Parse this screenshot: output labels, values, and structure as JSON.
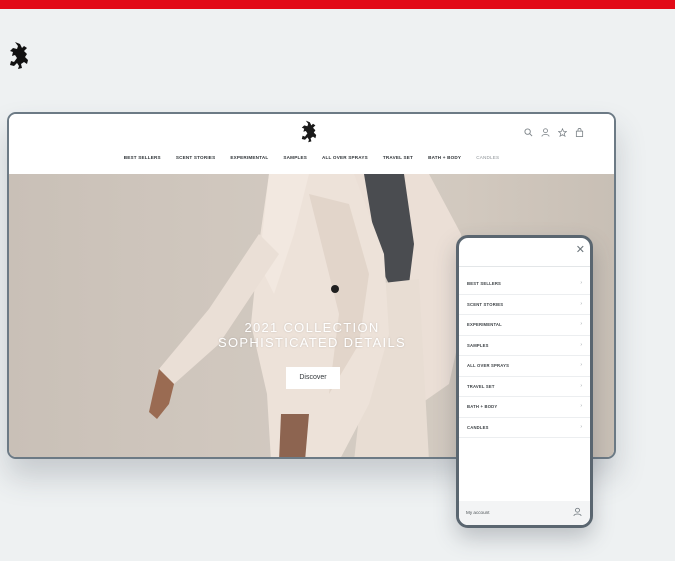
{
  "brand": {
    "accent_color": "#e20a17",
    "logo_icon": "heraldic-lion-icon"
  },
  "desktop": {
    "header_icons": [
      "search-icon",
      "account-icon",
      "wishlist-icon",
      "bag-icon"
    ],
    "nav": {
      "items": [
        "BEST SELLERS",
        "SCENT STORIES",
        "EXPERIMENTAL",
        "SAMPLES",
        "ALL OVER SPRAYS",
        "TRAVEL SET",
        "BATH + BODY",
        "CANDLES"
      ]
    },
    "hero": {
      "title_line1": "2021 COLLECTION",
      "title_line2": "SOPHISTICATED DETAILS",
      "button_label": "Discover"
    }
  },
  "mobile": {
    "close_symbol": "✕",
    "menu": {
      "items": [
        "BEST SELLERS",
        "SCENT STORIES",
        "EXPERIMENTAL",
        "SAMPLES",
        "ALL OVER SPRAYS",
        "TRAVEL SET",
        "BATH + BODY",
        "CANDLES"
      ],
      "chevron": "›"
    },
    "account_label": "My account"
  }
}
